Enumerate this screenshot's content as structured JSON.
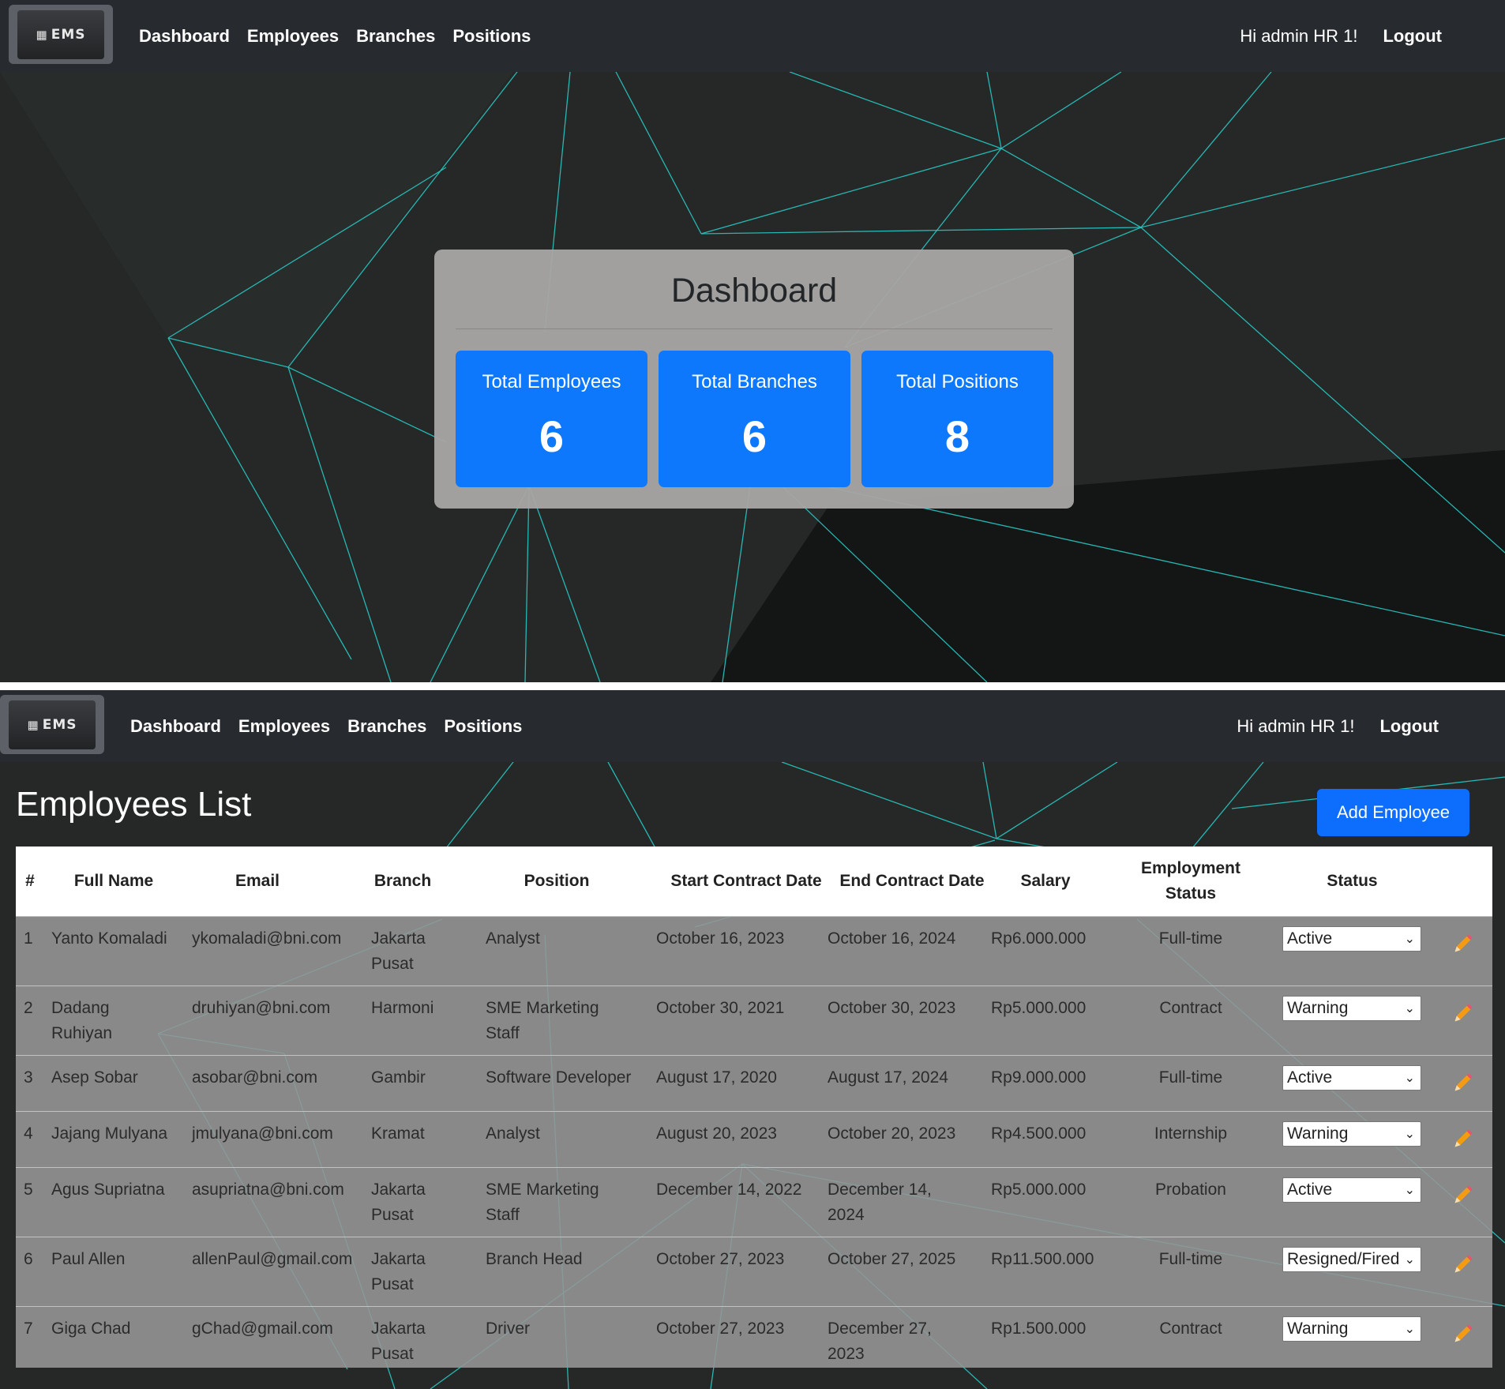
{
  "navbar": {
    "brand": "EMS",
    "links": [
      "Dashboard",
      "Employees",
      "Branches",
      "Positions"
    ],
    "greeting": "Hi admin HR 1!",
    "logout": "Logout"
  },
  "dashboard": {
    "title": "Dashboard",
    "cards": [
      {
        "label": "Total Employees",
        "value": "6"
      },
      {
        "label": "Total Branches",
        "value": "6"
      },
      {
        "label": "Total Positions",
        "value": "8"
      }
    ]
  },
  "employees_page": {
    "title": "Employees List",
    "add_button": "Add Employee",
    "columns": [
      "#",
      "Full Name",
      "Email",
      "Branch",
      "Position",
      "Start Contract Date",
      "End Contract Date",
      "Salary",
      "Employment Status",
      "Status"
    ],
    "rows": [
      {
        "no": "1",
        "name": "Yanto Komaladi",
        "email": "ykomaladi@bni.com",
        "branch": "Jakarta Pusat",
        "position": "Analyst",
        "start": "October 16, 2023",
        "end": "October 16, 2024",
        "salary": "Rp6.000.000",
        "employment": "Full-time",
        "status": "Active"
      },
      {
        "no": "2",
        "name": "Dadang Ruhiyan",
        "email": "druhiyan@bni.com",
        "branch": "Harmoni",
        "position": "SME Marketing Staff",
        "start": "October 30, 2021",
        "end": "October 30, 2023",
        "salary": "Rp5.000.000",
        "employment": "Contract",
        "status": "Warning"
      },
      {
        "no": "3",
        "name": "Asep Sobar",
        "email": "asobar@bni.com",
        "branch": "Gambir",
        "position": "Software Developer",
        "start": "August 17, 2020",
        "end": "August 17, 2024",
        "salary": "Rp9.000.000",
        "employment": "Full-time",
        "status": "Active"
      },
      {
        "no": "4",
        "name": "Jajang Mulyana",
        "email": "jmulyana@bni.com",
        "branch": "Kramat",
        "position": "Analyst",
        "start": "August 20, 2023",
        "end": "October 20, 2023",
        "salary": "Rp4.500.000",
        "employment": "Internship",
        "status": "Warning"
      },
      {
        "no": "5",
        "name": "Agus Supriatna",
        "email": "asupriatna@bni.com",
        "branch": "Jakarta Pusat",
        "position": "SME Marketing Staff",
        "start": "December 14, 2022",
        "end": "December 14, 2024",
        "salary": "Rp5.000.000",
        "employment": "Probation",
        "status": "Active"
      },
      {
        "no": "6",
        "name": "Paul Allen",
        "email": "allenPaul@gmail.com",
        "branch": "Jakarta Pusat",
        "position": "Branch Head",
        "start": "October 27, 2023",
        "end": "October 27, 2025",
        "salary": "Rp11.500.000",
        "employment": "Full-time",
        "status": "Resigned/Fired"
      },
      {
        "no": "7",
        "name": "Giga Chad",
        "email": "gChad@gmail.com",
        "branch": "Jakarta Pusat",
        "position": "Driver",
        "start": "October 27, 2023",
        "end": "December 27, 2023",
        "salary": "Rp1.500.000",
        "employment": "Contract",
        "status": "Warning"
      }
    ]
  },
  "icons": {
    "brand": "building-icon",
    "edit": "pencil-icon",
    "select": "chevron-down-icon"
  },
  "colors": {
    "navbar": "#272b30",
    "card_blue": "#0d78fb",
    "button_blue": "#0d6efd",
    "line_accent": "#27c7c2"
  }
}
